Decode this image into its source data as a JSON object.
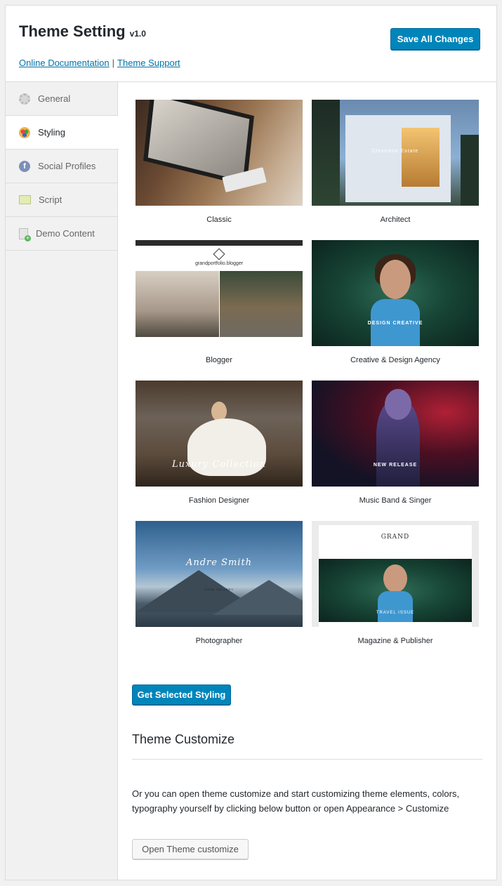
{
  "header": {
    "title": "Theme Setting",
    "version": "v1.0",
    "doc_link": "Online Documentation",
    "separator": "|",
    "support_link": "Theme Support",
    "save_label": "Save All Changes"
  },
  "sidebar": {
    "items": [
      {
        "label": "General",
        "icon": "gear-icon",
        "active": false
      },
      {
        "label": "Styling",
        "icon": "palette-icon",
        "active": true
      },
      {
        "label": "Social Profiles",
        "icon": "facebook-icon",
        "active": false
      },
      {
        "label": "Script",
        "icon": "css-icon",
        "active": false
      },
      {
        "label": "Demo Content",
        "icon": "document-add-icon",
        "active": false
      }
    ]
  },
  "stylings": [
    {
      "label": "Classic"
    },
    {
      "label": "Architect",
      "overlay": "Clevedon Estate"
    },
    {
      "label": "Blogger",
      "overlay": "grandportfolio.blogger"
    },
    {
      "label": "Creative & Design Agency",
      "overlay": "DESIGN CREATIVE"
    },
    {
      "label": "Fashion Designer",
      "overlay": "Luxury Collection"
    },
    {
      "label": "Music Band & Singer",
      "overlay": "NEW RELEASE"
    },
    {
      "label": "Photographer",
      "overlay": "Andre Smith",
      "button": "VIEW GALLERY"
    },
    {
      "label": "Magazine & Publisher",
      "overlay": "GRAND",
      "tag": "TRAVEL ISSUE"
    }
  ],
  "get_styling_label": "Get Selected Styling",
  "customize": {
    "title": "Theme Customize",
    "description": "Or you can open theme customize and start customizing theme elements, colors, typography yourself by clicking below button or open Appearance > Customize",
    "button_label": "Open Theme customize"
  },
  "colors": {
    "primary": "#0085ba",
    "link": "#0073aa"
  }
}
